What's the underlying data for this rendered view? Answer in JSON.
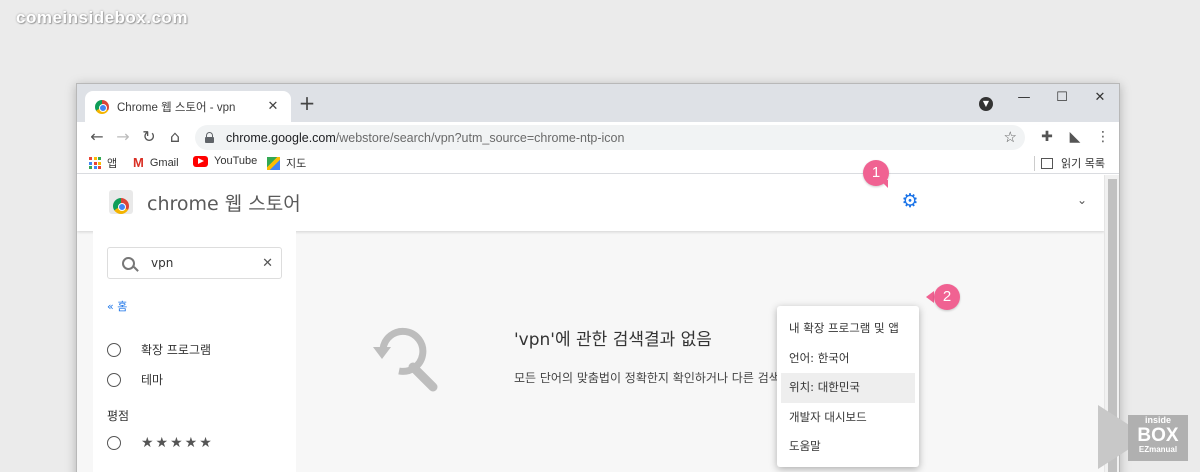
{
  "watermark": "comeinsidebox.com",
  "browser": {
    "tab_title": "Chrome 웹 스토어 - vpn",
    "tab_close": "✕",
    "new_tab": "+",
    "url_host": "chrome.google.com",
    "url_path": "/webstore/search/vpn?utm_source=chrome-ntp-icon",
    "bookmarks": [
      {
        "label": "앱",
        "icon": "apps-grid-icon"
      },
      {
        "label": "Gmail",
        "icon": "gmail-icon"
      },
      {
        "label": "YouTube",
        "icon": "youtube-icon"
      },
      {
        "label": "지도",
        "icon": "maps-icon"
      }
    ],
    "reading_list": "읽기 목록"
  },
  "store": {
    "title": "chrome 웹 스토어",
    "search_value": "vpn",
    "home_link": "« 홈",
    "filters": [
      "확장 프로그램",
      "테마"
    ],
    "rating_label": "평점",
    "stars": "★★★★★",
    "result_title": "'vpn'에 관한 검색결과 없음",
    "result_sub": "모든 단어의 맞춤법이 정확한지 확인하거나 다른 검색어로 검색해 보세요."
  },
  "settings_menu": {
    "items": [
      "내 확장 프로그램 및 앱",
      "언어: 한국어",
      "위치: 대한민국",
      "개발자 대시보드",
      "도움말"
    ],
    "active_index": 2
  },
  "callouts": [
    "1",
    "2"
  ],
  "brand": {
    "top": "inside",
    "main": "BOX",
    "bottom": "EZmanual"
  },
  "colors": {
    "accent": "#1a73e8",
    "callout": "#f06292"
  }
}
